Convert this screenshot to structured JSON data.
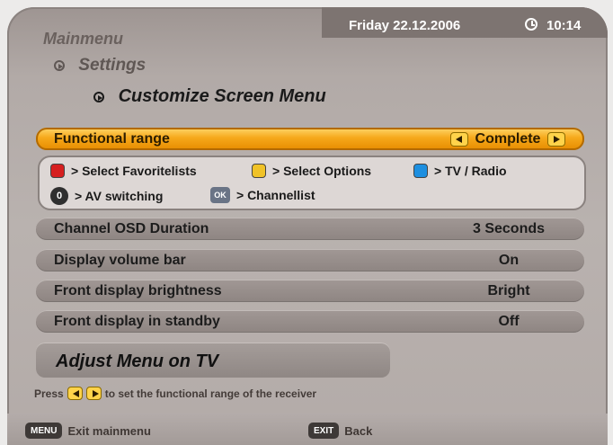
{
  "header": {
    "date": "Friday 22.12.2006",
    "time": "10:14",
    "clock_icon": "clock-icon"
  },
  "breadcrumbs": {
    "level1": "Mainmenu",
    "level2": "Settings",
    "level3": "Customize Screen Menu"
  },
  "active_row": {
    "label": "Functional range",
    "value": "Complete"
  },
  "legend": {
    "red_label": "> Select Favoritelists",
    "yellow_label": "> Select Options",
    "blue_label": "> TV / Radio",
    "zero_key": "0",
    "zero_label": "> AV switching",
    "ok_key": "OK",
    "ok_label": "> Channellist",
    "colors": {
      "red": "#d61f1f",
      "yellow": "#f0c227",
      "blue": "#1d8fe0"
    }
  },
  "settings": [
    {
      "label": "Channel OSD Duration",
      "value": "3 Seconds"
    },
    {
      "label": "Display volume bar",
      "value": "On"
    },
    {
      "label": "Front display brightness",
      "value": "Bright"
    },
    {
      "label": "Front display in standby",
      "value": "Off"
    }
  ],
  "tv_adjust": {
    "label": "Adjust Menu on TV"
  },
  "hint": {
    "prefix": "Press",
    "suffix": "to set the functional range of the receiver"
  },
  "footer": {
    "menu_key": "MENU",
    "menu_label": "Exit mainmenu",
    "exit_key": "EXIT",
    "exit_label": "Back"
  },
  "theme": {
    "accent": "#f6a81a",
    "panel": "#b9b2af"
  }
}
